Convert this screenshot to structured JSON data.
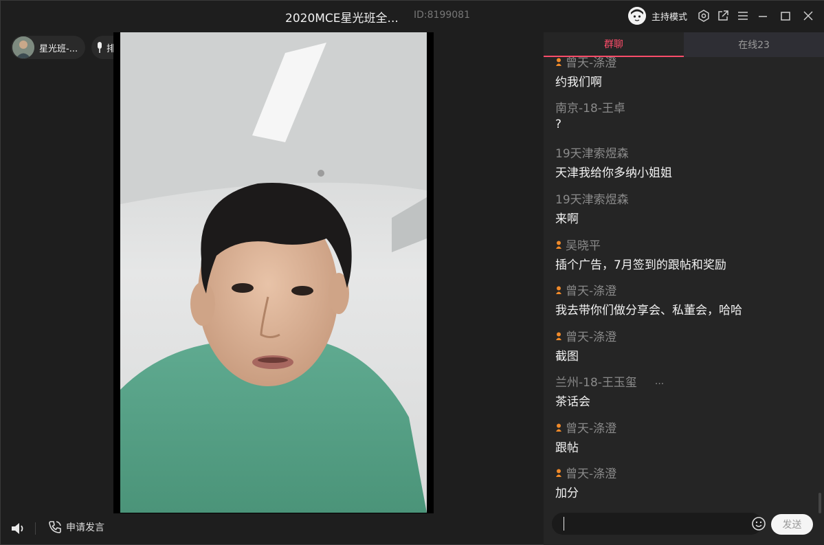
{
  "window": {
    "title": "2020MCE星光班全...",
    "room_id": "ID:8199081",
    "host_mode_label": "主持模式"
  },
  "left": {
    "room_chip_label": "星光班-...",
    "mic_queue_label": "排麦",
    "apply_speak_label": "申请发言"
  },
  "chat": {
    "tabs": [
      {
        "label": "群聊"
      },
      {
        "label": "在线23"
      }
    ],
    "messages": [
      {
        "name": "曾天-涤澄",
        "badge": true,
        "text": "约我们啊"
      },
      {
        "name": "南京-18-王卓",
        "badge": false,
        "text": "?"
      },
      {
        "name": "19天津索煜森",
        "badge": false,
        "text": "天津我给你多纳小姐姐"
      },
      {
        "name": "19天津索煜森",
        "badge": false,
        "text": "来啊"
      },
      {
        "name": "吴晓平",
        "badge": true,
        "text": "插个广告，7月签到的跟帖和奖励"
      },
      {
        "name": "曾天-涤澄",
        "badge": true,
        "text": "我去带你们做分享会、私董会，哈哈"
      },
      {
        "name": "曾天-涤澄",
        "badge": true,
        "text": "截图"
      },
      {
        "name": "兰州-18-王玉玺",
        "badge": false,
        "extra": "...",
        "text": "茶话会"
      },
      {
        "name": "曾天-涤澄",
        "badge": true,
        "text": "跟帖"
      },
      {
        "name": "曾天-涤澄",
        "badge": true,
        "text": "加分"
      }
    ],
    "send_label": "发送",
    "input_value": ""
  },
  "colors": {
    "accent": "#ff4d6a",
    "badge": "#f08a2a",
    "background": "#1e1e1e",
    "panel": "#252525"
  }
}
